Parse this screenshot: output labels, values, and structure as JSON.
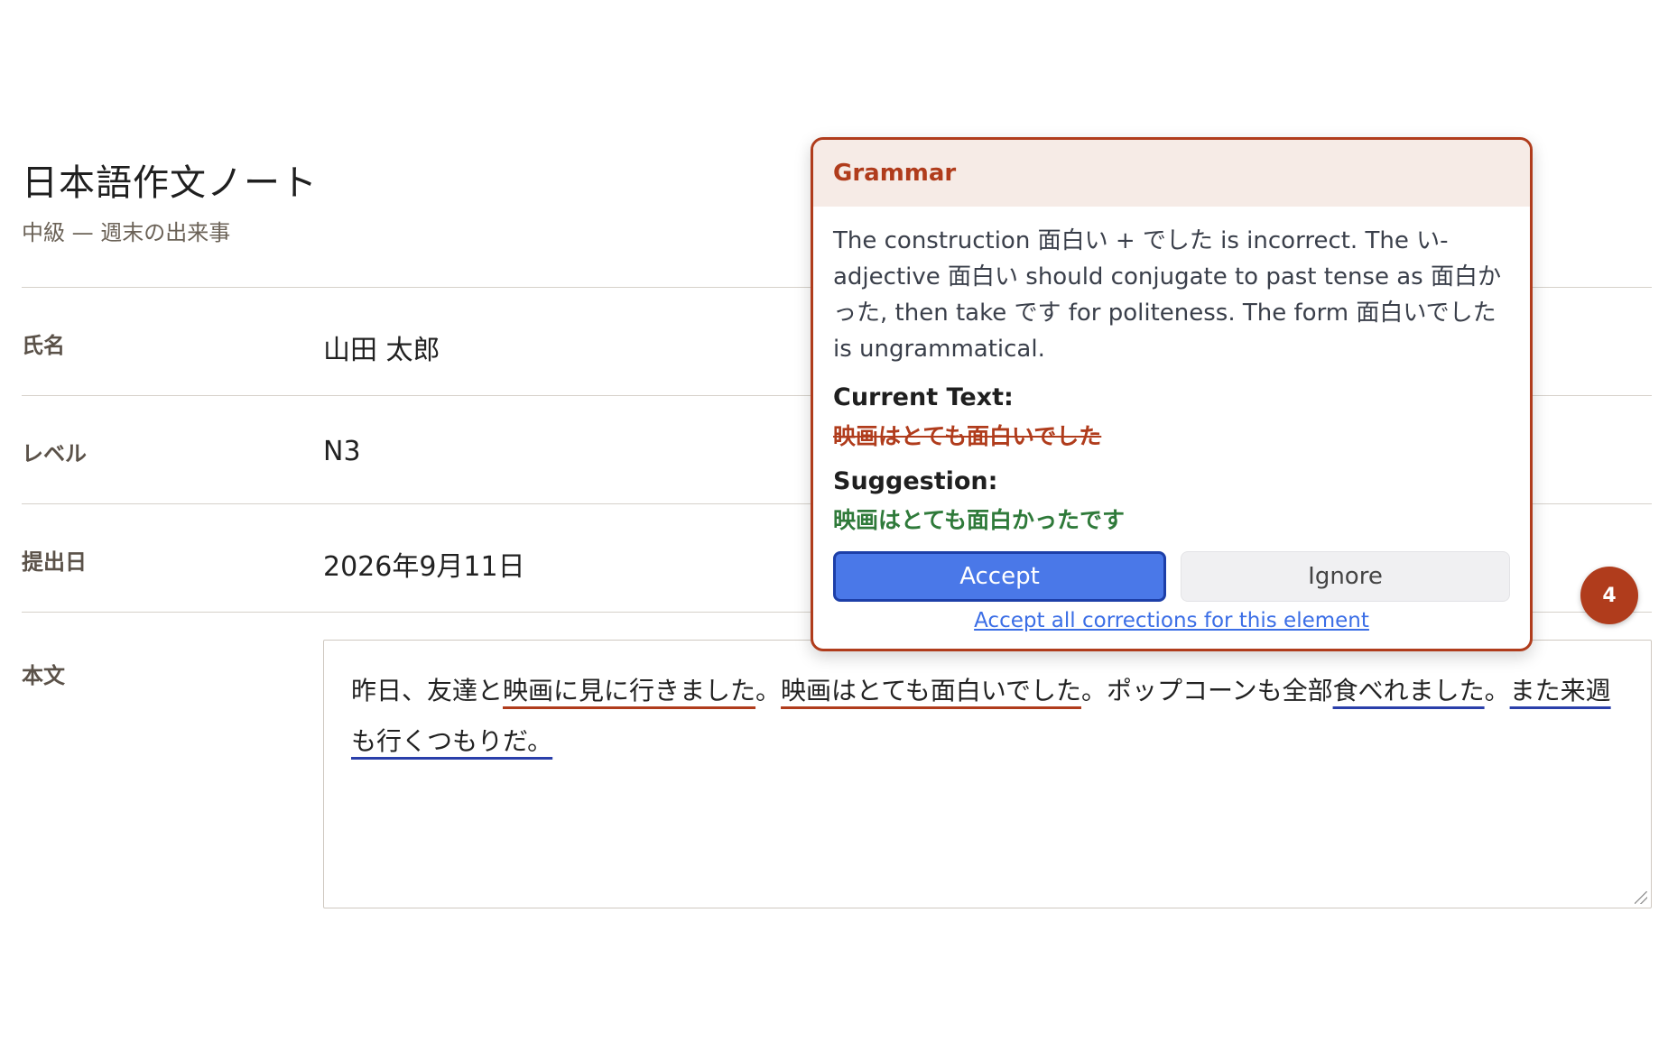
{
  "header": {
    "title": "日本語作文ノート",
    "subtitle": "中級 — 週末の出来事"
  },
  "form": {
    "rows": [
      {
        "label": "氏名",
        "value": "山田 太郎"
      },
      {
        "label": "レベル",
        "value": "N3"
      },
      {
        "label": "提出日",
        "value": "2026年9月11日"
      }
    ],
    "body": {
      "label": "本文",
      "segments": [
        {
          "text": "昨日、友達と",
          "mark": "none"
        },
        {
          "text": "映画に見に行きました",
          "mark": "grammar"
        },
        {
          "text": "。",
          "mark": "none"
        },
        {
          "text": "映画はとても面白いでした",
          "mark": "grammar"
        },
        {
          "text": "。ポップコーンも全部",
          "mark": "none"
        },
        {
          "text": "食べれました",
          "mark": "style"
        },
        {
          "text": "。",
          "mark": "none"
        },
        {
          "text": "また来週も行くつもりだ。",
          "mark": "style"
        }
      ]
    }
  },
  "badge": {
    "count": "4"
  },
  "popup": {
    "category": "Grammar",
    "message": "The construction 面白い + でした is incorrect. The い-adjective 面白い should conjugate to past tense as 面白かった, then take です for politeness. The form 面白いでした is ungrammatical.",
    "current_label": "Current Text:",
    "current_text": "映画はとても面白いでした",
    "suggestion_label": "Suggestion:",
    "suggestion_text": "映画はとても面白かったです",
    "accept_label": "Accept",
    "ignore_label": "Ignore",
    "accept_all_label": "Accept all corrections for this element"
  },
  "colors": {
    "grammar": "#b03c1c",
    "style": "#2a3faa",
    "accept": "#4a78e8",
    "suggestion": "#2f7a3a"
  }
}
